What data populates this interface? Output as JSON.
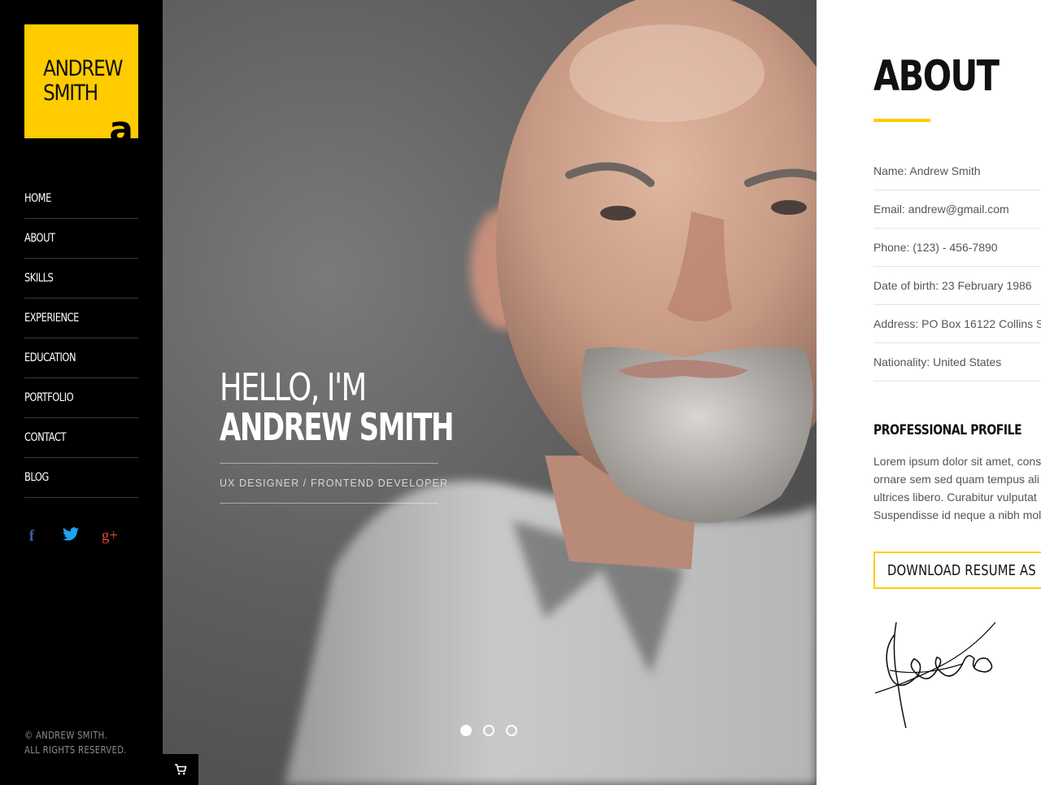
{
  "sidebar": {
    "logo": {
      "line1": "ANDREW",
      "line2": "SMITH",
      "mark": "a"
    },
    "nav": [
      {
        "label": "HOME"
      },
      {
        "label": "ABOUT"
      },
      {
        "label": "SKILLS"
      },
      {
        "label": "EXPERIENCE"
      },
      {
        "label": "EDUCATION"
      },
      {
        "label": "PORTFOLIO"
      },
      {
        "label": "CONTACT"
      },
      {
        "label": "BLOG"
      }
    ],
    "social": {
      "facebook": "f",
      "twitter": "🐦",
      "google_plus": "g+"
    },
    "copyright_line1": "© ANDREW SMITH.",
    "copyright_line2": "ALL RIGHTS RESERVED."
  },
  "hero": {
    "greeting": "HELLO, I'M",
    "name": "ANDREW SMITH",
    "role": "UX DESIGNER / FRONTEND DEVELOPER",
    "slides": 3,
    "active_slide": 1
  },
  "about": {
    "title": "ABOUT",
    "info": [
      "Name: Andrew Smith",
      "Email: andrew@gmail.com",
      "Phone: (123) - 456-7890",
      "Date of birth: 23 February 1986",
      "Address: PO Box 16122 Collins S",
      "Nationality: United States"
    ],
    "profile_title": "PROFESSIONAL PROFILE",
    "profile_lines": [
      "Lorem ipsum dolor sit amet, cons",
      "ornare sem sed quam tempus ali",
      "ultrices libero. Curabitur vulputat",
      "Suspendisse id neque a nibh mol"
    ],
    "download_label": "DOWNLOAD RESUME AS PD"
  },
  "colors": {
    "accent": "#ffcc00",
    "sidebar_bg": "#000000",
    "facebook": "#3b5998",
    "twitter": "#1da1f2",
    "google_plus": "#dd4b39"
  },
  "icons": {
    "cart": "cart-icon",
    "facebook": "facebook-icon",
    "twitter": "twitter-icon",
    "google_plus": "google-plus-icon"
  }
}
